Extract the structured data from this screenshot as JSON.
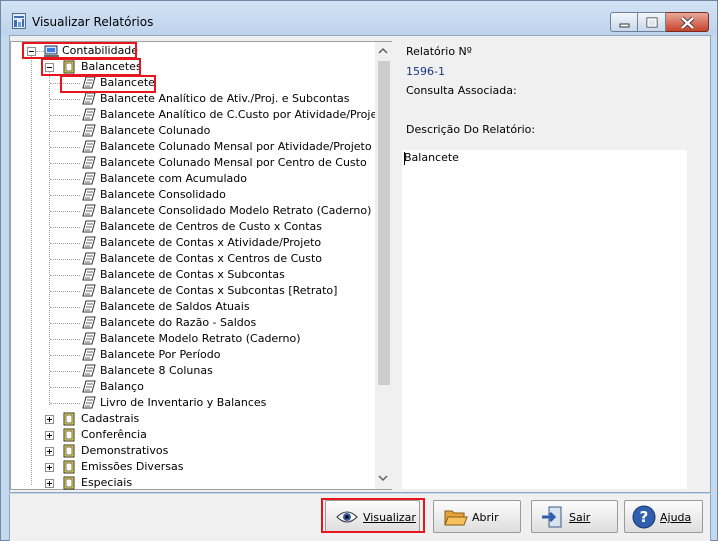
{
  "window": {
    "title": "Visualizar Relatórios"
  },
  "tree": {
    "root": "Contabilidade",
    "group_open": "Balancetes",
    "items": [
      "Balancete",
      "Balancete Analítico de Ativ./Proj. e Subcontas",
      "Balancete Analítico de C.Custo por Atividade/Projeto",
      "Balancete Colunado",
      "Balancete Colunado Mensal por Atividade/Projeto",
      "Balancete Colunado Mensal por Centro de Custo",
      "Balancete com Acumulado",
      "Balancete Consolidado",
      "Balancete Consolidado Modelo Retrato (Caderno)",
      "Balancete de Centros de Custo x Contas",
      "Balancete de Contas x Atividade/Projeto",
      "Balancete de Contas x Centros de Custo",
      "Balancete de Contas x Subcontas",
      "Balancete de Contas x Subcontas [Retrato]",
      "Balancete de Saldos Atuais",
      "Balancete do Razão - Saldos",
      "Balancete Modelo Retrato (Caderno)",
      "Balancete Por Período",
      "Balancete 8 Colunas",
      "Balanço",
      "Livro de Inventario y Balances"
    ],
    "groups_closed": [
      "Cadastrais",
      "Conferência",
      "Demonstrativos",
      "Emissões Diversas",
      "Especiais"
    ]
  },
  "details": {
    "report_number_label": "Relatório Nº",
    "report_number_value": "1596-1",
    "associated_query_label": "Consulta Associada:",
    "description_label": "Descrição Do Relatório:",
    "description_value": "Balancete"
  },
  "buttons": {
    "view": "Visualizar",
    "open": "Abrir",
    "exit": "Sair",
    "help": "Ajuda"
  },
  "colors": {
    "highlight_border": "#e8141e",
    "number_value": "#1a3580"
  }
}
